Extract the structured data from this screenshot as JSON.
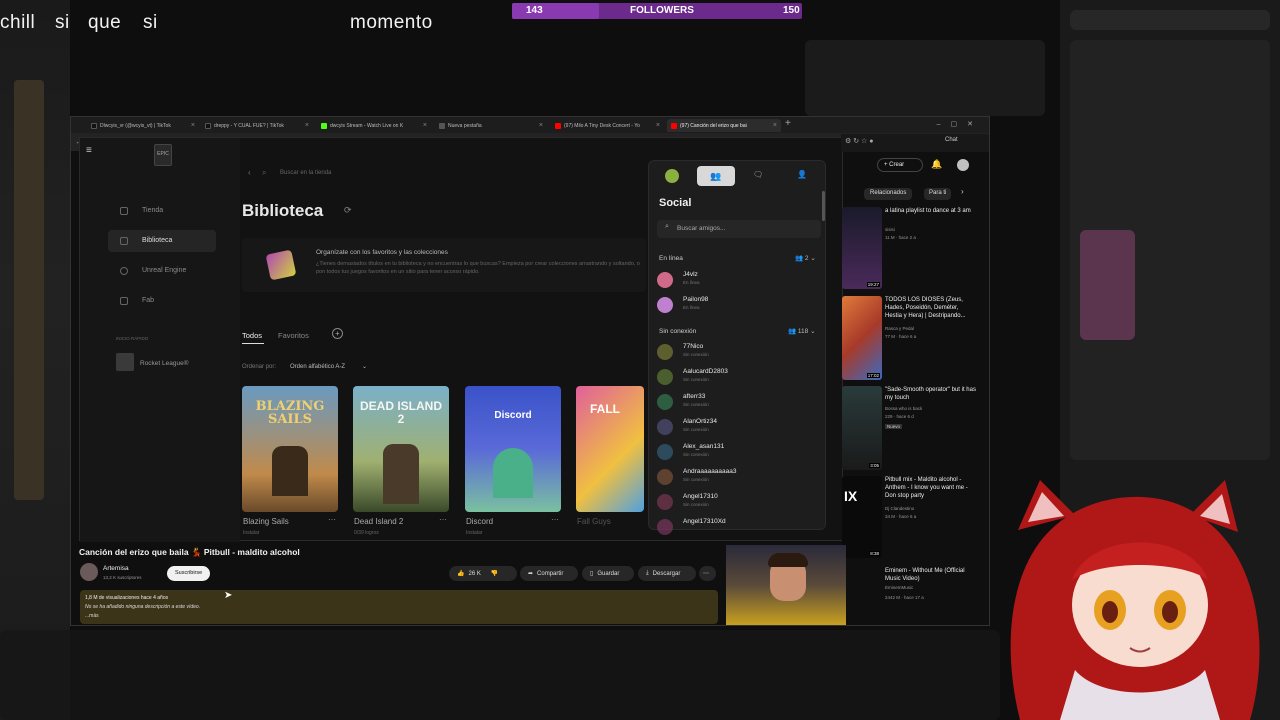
{
  "overlay": {
    "word1": "chill",
    "word2": "si",
    "word3": "que",
    "word4": "si",
    "word5": "momento",
    "followers_label": "FOLLOWERS",
    "followers_current": "143",
    "followers_goal": "150",
    "followers_progress": 0.3
  },
  "browser": {
    "tabs": [
      {
        "label": "Dlwcyis_vr (@wcyis_vt) | TikTok",
        "color": "#111111"
      },
      {
        "label": "dreppy - Y CUAL FUE? | TikTok",
        "color": "#111111"
      },
      {
        "label": "dwcyis Stream - Watch Live on K",
        "color": "#53fc18"
      },
      {
        "label": "Nueva pestaña",
        "color": "#555555"
      },
      {
        "label": "(97) Milo A Tiny Desk Concert - Yo",
        "color": "#ff0000"
      },
      {
        "label": "(97) Canción del erizo que bai",
        "color": "#ff0000"
      }
    ],
    "new_tab": "+"
  },
  "epic": {
    "search_placeholder": "Buscar en la tienda",
    "nav": [
      "Tienda",
      "Biblioteca",
      "Unreal Engine",
      "Fab"
    ],
    "quick_launch": "INICIO RÁPIDO",
    "quick_game": "Rocket League®",
    "page_title": "Biblioteca",
    "banner_title": "Organízate con los favoritos y las colecciones",
    "banner_text": "¿Tienes demasiados títulos en tu biblioteca y no encuentras lo que buscas? Empieza por crear colecciones arrastrando y soltando, o pon todos tus juegos favoritos en un sitio para tener acceso rápido.",
    "tab_all": "Todos",
    "tab_fav": "Favoritos",
    "sort_label": "Ordenar por:",
    "sort_value": "Orden alfabético A-Z",
    "games": [
      {
        "title": "Blazing Sails",
        "sub": "Instalar",
        "logo": "BLAZING SAILS"
      },
      {
        "title": "Dead Island 2",
        "sub": "0/39 logros",
        "logo": "DEAD ISLAND 2"
      },
      {
        "title": "Discord",
        "sub": "Instalar",
        "logo": "Discord"
      },
      {
        "title": "Fall Guys",
        "sub": "Instalar",
        "logo": "FALL"
      }
    ]
  },
  "social": {
    "title": "Social",
    "search_placeholder": "Buscar amigos...",
    "online_label": "En línea",
    "online_count": "2",
    "offline_label": "Sin conexión",
    "offline_count": "118",
    "online": [
      {
        "name": "J4vlz",
        "status": "En línea",
        "color": "#d06a8a"
      },
      {
        "name": "Pailon98",
        "status": "En línea",
        "color": "#c080d0"
      }
    ],
    "offline": [
      {
        "name": "77Nico",
        "status": "Sin conexión",
        "color": "#8a8a3a"
      },
      {
        "name": "AalucardD2803",
        "status": "Sin conexión",
        "color": "#6a8a3a"
      },
      {
        "name": "afterr33",
        "status": "Sin conexión",
        "color": "#3a8a5a"
      },
      {
        "name": "AlanOrtiz34",
        "status": "Sin conexión",
        "color": "#5a5a8a"
      },
      {
        "name": "Alex_asan131",
        "status": "Sin conexión",
        "color": "#3a6a8a"
      },
      {
        "name": "Andraaaaaaaaaa3",
        "status": "Sin conexión",
        "color": "#8a5a3a"
      },
      {
        "name": "Angel17310",
        "status": "Sin conexión",
        "color": "#8a3a5a"
      },
      {
        "name": "Angel17310Xd",
        "status": "",
        "color": "#8a3a6a"
      }
    ]
  },
  "youtube": {
    "create_label": "Crear",
    "chat_label": "Chat",
    "chips": [
      "Relacionados",
      "Para ti"
    ],
    "related": [
      {
        "title": "a latina playlist to dance at 3 am",
        "channel": "sisisi",
        "meta": "11 M · hace 2 a",
        "duration": "19:27",
        "thumb": "#3a2a40"
      },
      {
        "title": "TODOS LOS DIOSES (Zeus, Hades, Poseidón, Deméter, Hestia y Hera) | Destripando...",
        "channel": "Rasca y Pedal",
        "meta": "77 M · hace 6 a",
        "duration": "17:02",
        "thumb": "#a83a2a"
      },
      {
        "title": "\"Sade-Smooth operator\" but it has my touch",
        "channel": "Bossa who is back",
        "meta": "229 · hace 6 d",
        "duration": "3:05",
        "thumb": "#2a2a2a",
        "badge": "Nuevo"
      },
      {
        "title": "Pitbull mix - Maldito alcohol - Anthem - I know you want me - Don stop party",
        "channel": "Dj Clandestino",
        "meta": "34 M · hace 6 a",
        "duration": "8:38",
        "thumb": "#111111"
      },
      {
        "title": "Eminem - Without Me (Official Music Video)",
        "channel": "EminemMusic",
        "meta": "2442 M · hace 17 a",
        "duration": "",
        "thumb": "#c8a020"
      }
    ],
    "video_title": "Canción del erizo que baila 💃 Pitbull - maldito alcohol",
    "channel_name": "Artemisa",
    "subscribers": "13,2 K suscriptores",
    "subscribe_label": "Suscribirse",
    "likes": "26 K",
    "share": "Compartir",
    "save": "Guardar",
    "download": "Descargar",
    "views_line": "1,8 M de visualizaciones  hace 4 años",
    "desc_line": "No se ha añadido ninguna descripción a este vídeo.",
    "more_line": "...más"
  }
}
